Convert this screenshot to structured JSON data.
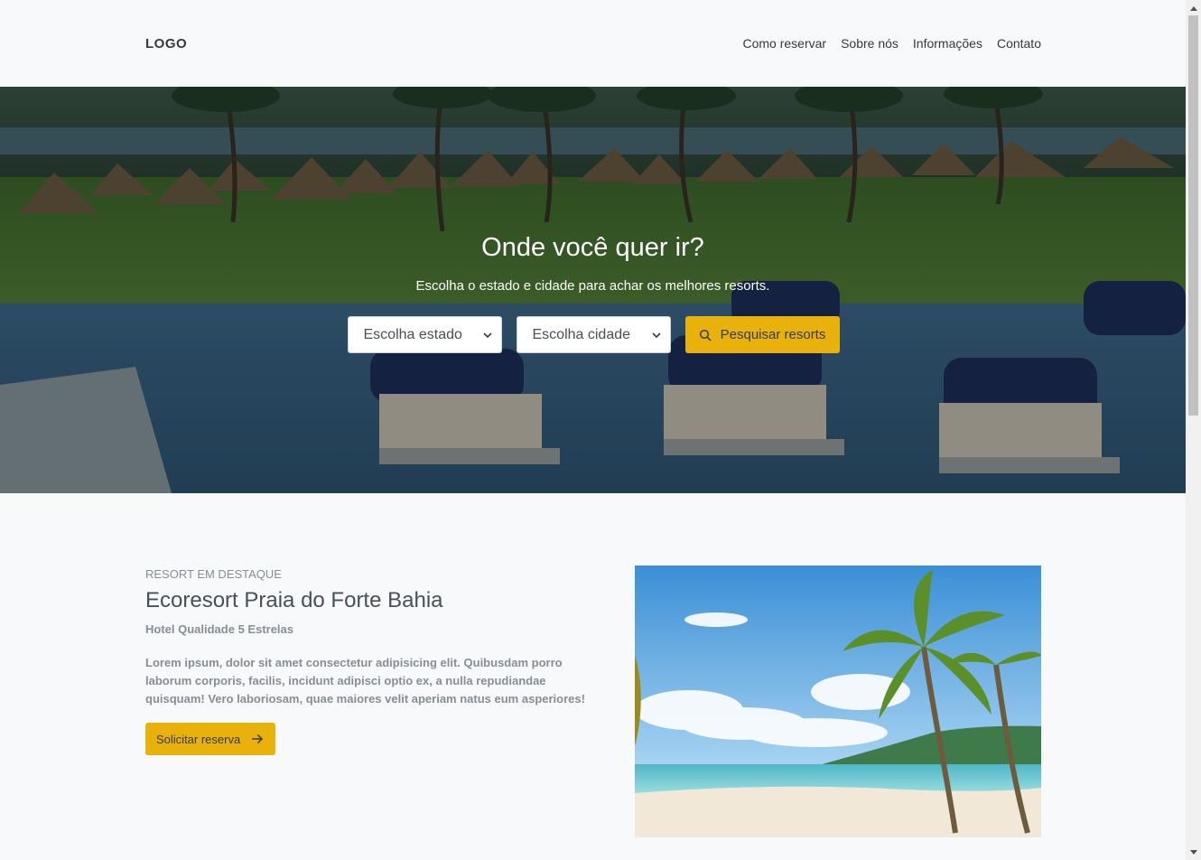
{
  "header": {
    "logo": "LOGO",
    "nav": [
      "Como reservar",
      "Sobre nós",
      "Informações",
      "Contato"
    ]
  },
  "hero": {
    "title": "Onde você quer ir?",
    "subtitle": "Escolha o estado e cidade para achar os melhores resorts.",
    "state_select": "Escolha estado",
    "city_select": "Escolha cidade",
    "search_button": "Pesquisar resorts"
  },
  "featured": {
    "eyebrow": "RESORT EM DESTAQUE",
    "title": "Ecoresort Praia do Forte Bahia",
    "subtitle": "Hotel Qualidade 5 Estrelas",
    "description": "Lorem ipsum, dolor sit amet consectetur adipisicing elit. Quibusdam porro laborum corporis, facilis, incidunt adipisci optio ex, a nulla repudiandae quisquam! Vero laboriosam, quae maiores velit aperiam natus eum asperiores!",
    "button": "Solicitar reserva"
  },
  "colors": {
    "accent": "#e9b10c",
    "background": "#f8f9fa",
    "text": "#343a40"
  },
  "icons": {
    "search": "search-icon",
    "arrow": "arrow-right-icon",
    "select_caret": "chevron-down-icon"
  }
}
